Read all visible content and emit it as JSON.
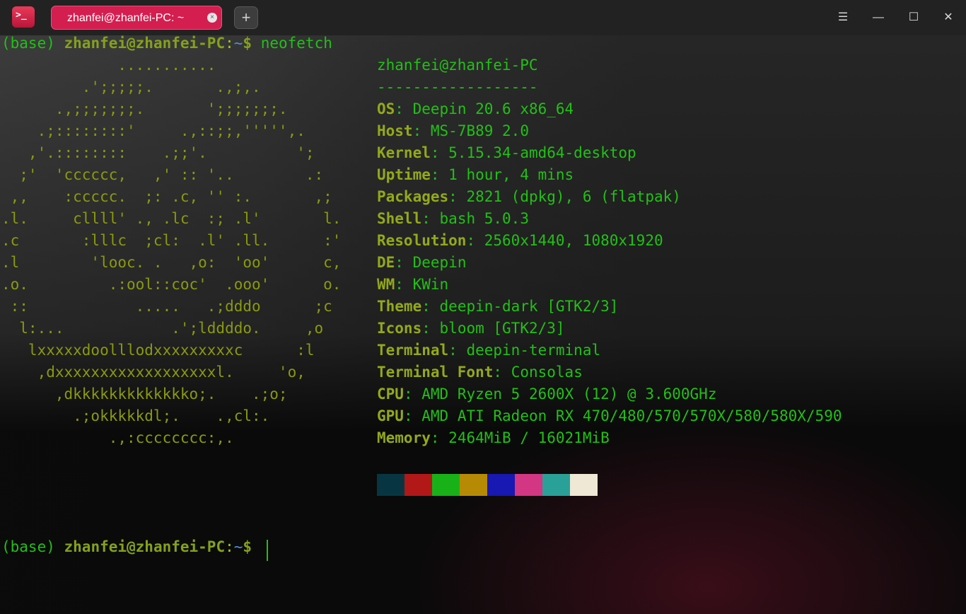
{
  "window": {
    "tab_title": "zhanfei@zhanfei-PC: ~",
    "tab_close": "×",
    "add_tab": "+",
    "app_icon_glyph": ">_",
    "controls": {
      "menu": "☰",
      "minimize": "—",
      "maximize": "☐",
      "close": "✕"
    }
  },
  "prompt": {
    "env": "(base)",
    "user_host": "zhanfei@zhanfei-PC",
    "colon": ":",
    "path": "~",
    "dollar": "$",
    "command": "neofetch"
  },
  "ascii_art": [
    "             ...........",
    "         .';;;;;.       .,;,.",
    "      .,;;;;;;;.       ';;;;;;;.",
    "    .;::::::::'     .,::;;,''''',.",
    "   ,'.::::::::    .;;'.          ';",
    "  ;'  'cccccc,   ,' :: '..        .:",
    " ,,    :ccccc.  ;: .c, '' :.       ,;",
    ".l.     cllll' ., .lc  :; .l'       l.",
    ".c       :lllc  ;cl:  .l' .ll.      :'",
    ".l        'looc. .   ,o:  'oo'      c,",
    ".o.         .:ool::coc'  .ooo'      o.",
    " ::            .....   .;dddo      ;c",
    "  l:...            .';lddddo.     ,o",
    "   lxxxxxdoolllodxxxxxxxxxc      :l",
    "    ,dxxxxxxxxxxxxxxxxxxl.     'o,",
    "      ,dkkkkkkkkkkkkko;.    .;o;",
    "        .;okkkkkdl;.    .,cl:.",
    "            .,:cccccccc:,."
  ],
  "info": {
    "title": "zhanfei@zhanfei-PC",
    "separator": "------------------",
    "rows": [
      {
        "key": "OS",
        "value": "Deepin 20.6 x86_64"
      },
      {
        "key": "Host",
        "value": "MS-7B89 2.0"
      },
      {
        "key": "Kernel",
        "value": "5.15.34-amd64-desktop"
      },
      {
        "key": "Uptime",
        "value": "1 hour, 4 mins"
      },
      {
        "key": "Packages",
        "value": "2821 (dpkg), 6 (flatpak)"
      },
      {
        "key": "Shell",
        "value": "bash 5.0.3"
      },
      {
        "key": "Resolution",
        "value": "2560x1440, 1080x1920"
      },
      {
        "key": "DE",
        "value": "Deepin"
      },
      {
        "key": "WM",
        "value": "KWin"
      },
      {
        "key": "Theme",
        "value": "deepin-dark [GTK2/3]"
      },
      {
        "key": "Icons",
        "value": "bloom [GTK2/3]"
      },
      {
        "key": "Terminal",
        "value": "deepin-terminal"
      },
      {
        "key": "Terminal Font",
        "value": "Consolas"
      },
      {
        "key": "CPU",
        "value": "AMD Ryzen 5 2600X (12) @ 3.600GHz"
      },
      {
        "key": "GPU",
        "value": "AMD ATI Radeon RX 470/480/570/570X/580/580X/590"
      },
      {
        "key": "Memory",
        "value": "2464MiB / 16021MiB"
      }
    ],
    "key_suffix": ":"
  },
  "palette": [
    "#073642",
    "#b21818",
    "#18b218",
    "#b68a05",
    "#1818b2",
    "#d33682",
    "#2aa198",
    "#eee8d5"
  ]
}
